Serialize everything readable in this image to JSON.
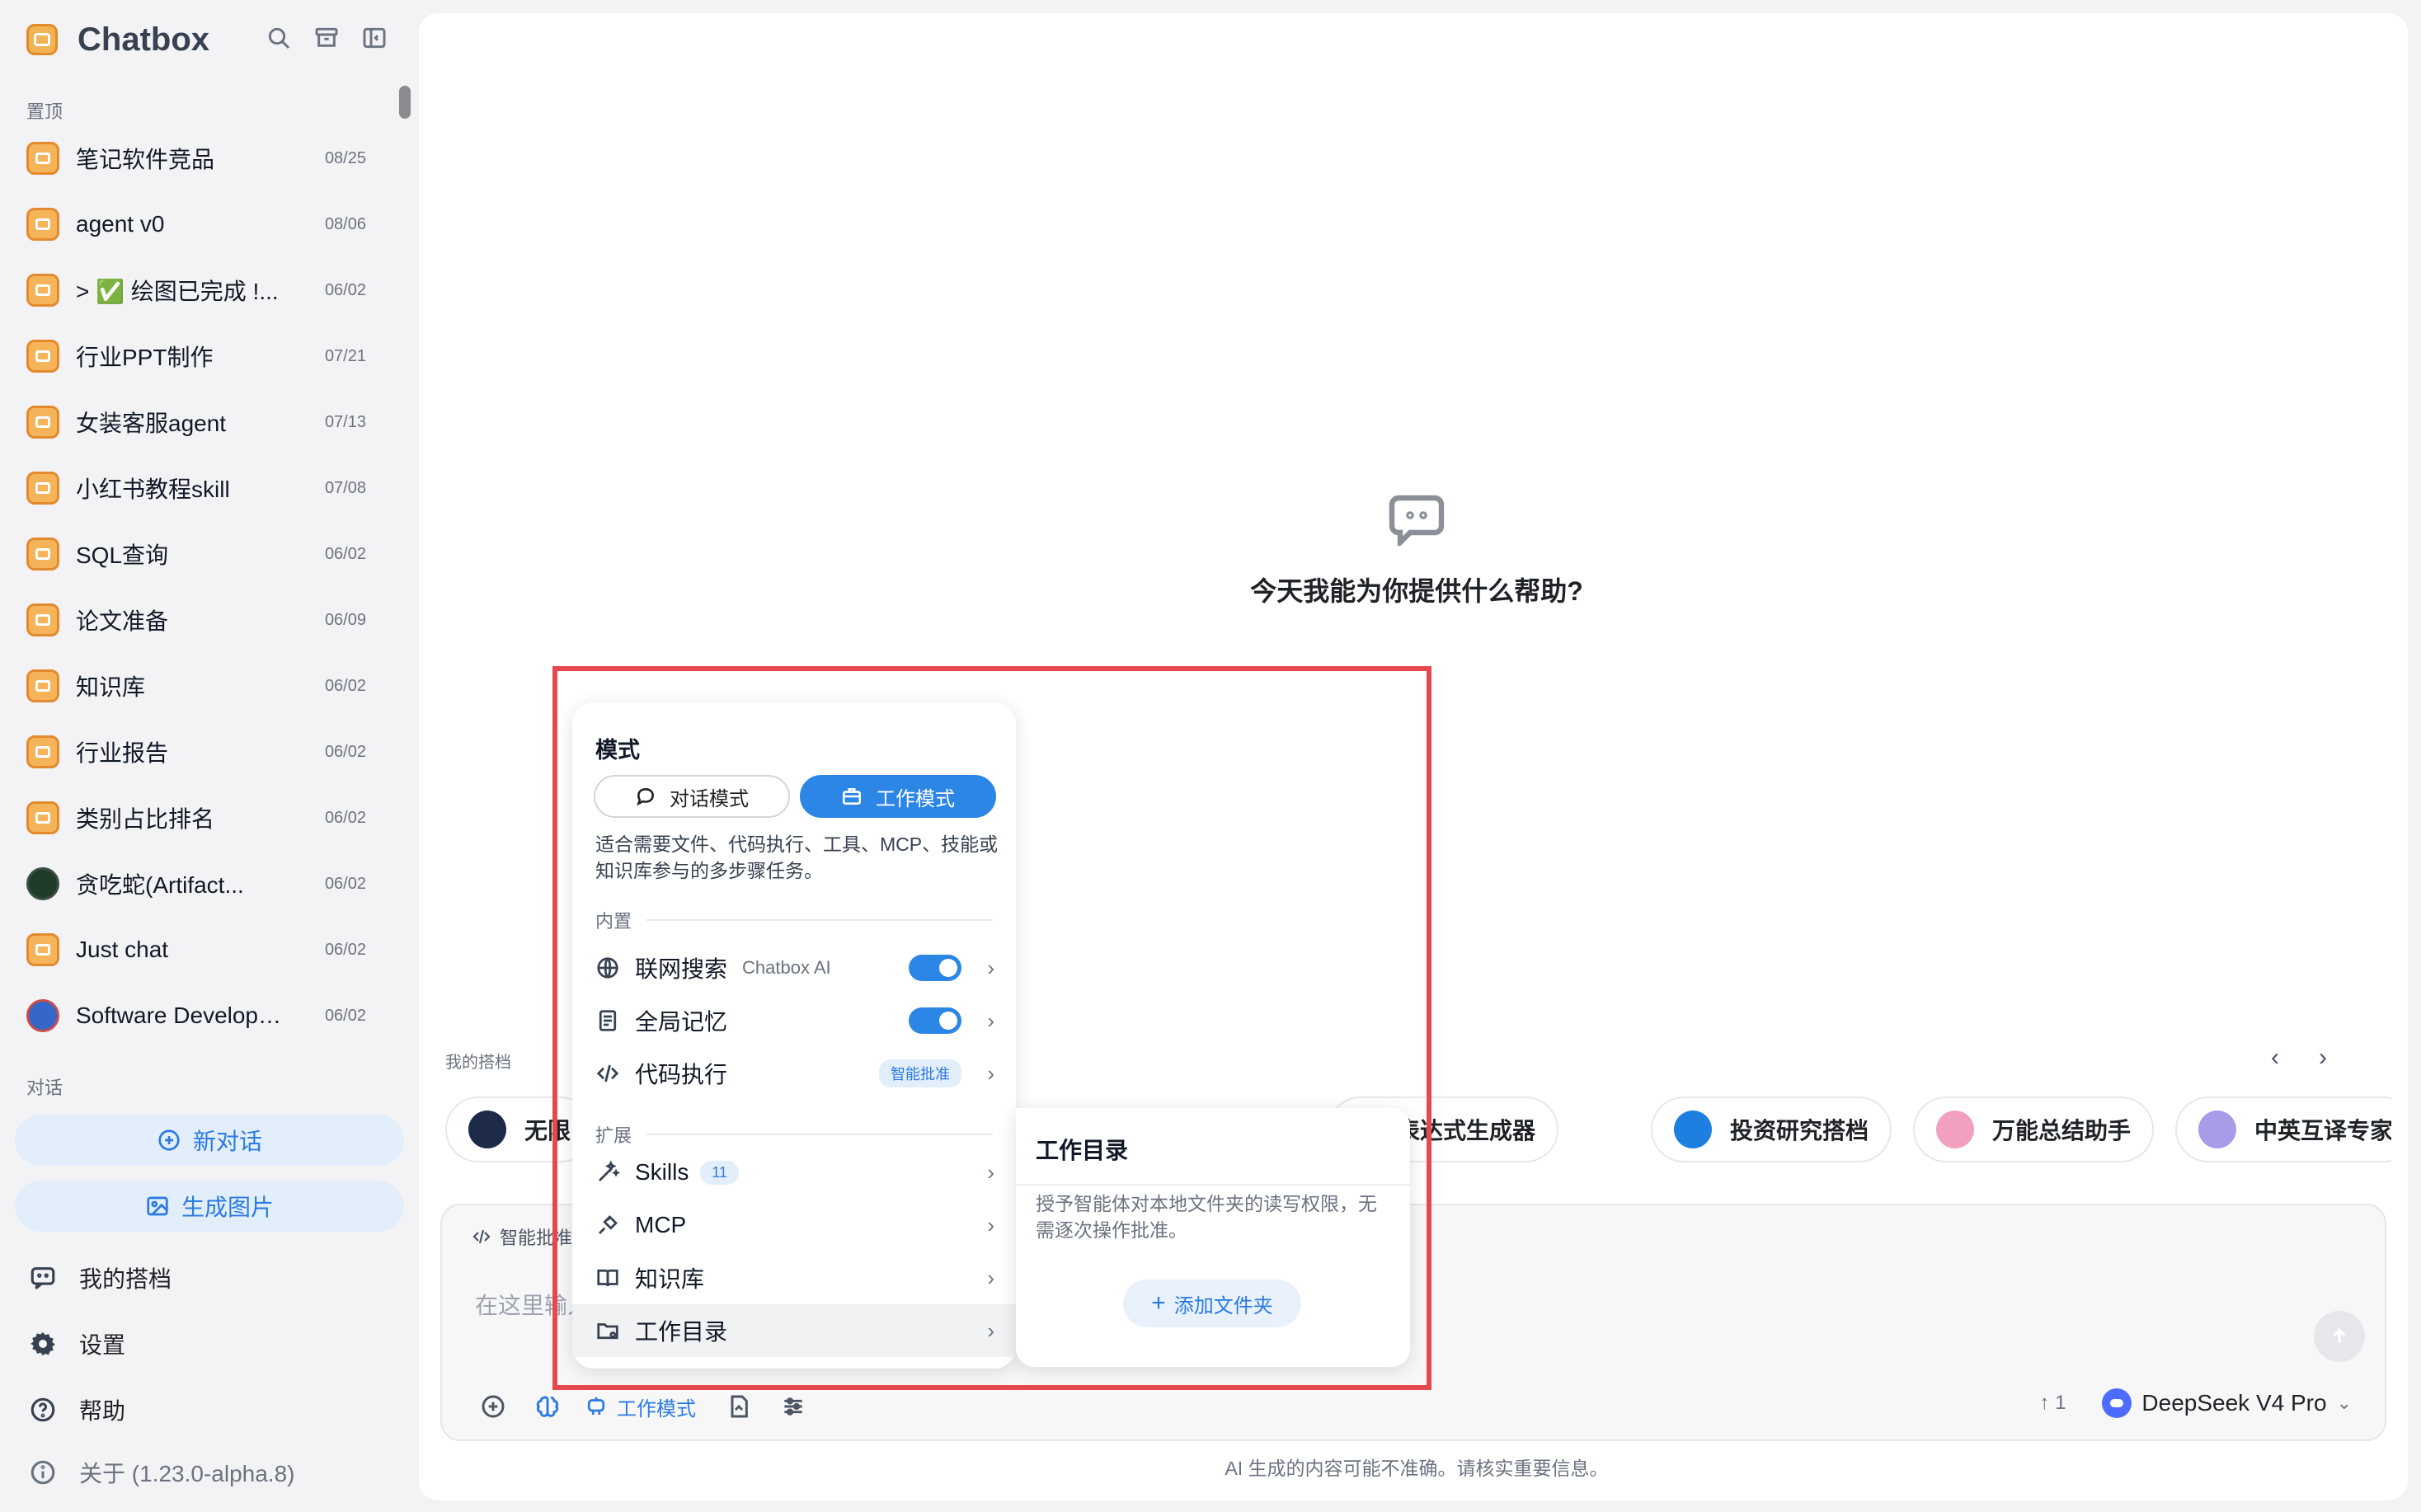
{
  "app": {
    "title": "Chatbox"
  },
  "sidebar": {
    "pinned_label": "置顶",
    "conversations_label": "对话",
    "items": [
      {
        "name": "笔记软件竞品",
        "date": "08/25",
        "avatar": "chatbox"
      },
      {
        "name": "agent v0",
        "date": "08/06",
        "avatar": "chatbox"
      },
      {
        "name": "> ✅ 绘图已完成 !...",
        "date": "06/02",
        "avatar": "chatbox"
      },
      {
        "name": "行业PPT制作",
        "date": "07/21",
        "avatar": "chatbox"
      },
      {
        "name": "女装客服agent",
        "date": "07/13",
        "avatar": "chatbox"
      },
      {
        "name": "小红书教程skill",
        "date": "07/08",
        "avatar": "chatbox"
      },
      {
        "name": "SQL查询",
        "date": "06/02",
        "avatar": "chatbox"
      },
      {
        "name": "论文准备",
        "date": "06/09",
        "avatar": "chatbox"
      },
      {
        "name": "知识库",
        "date": "06/02",
        "avatar": "chatbox"
      },
      {
        "name": "行业报告",
        "date": "06/02",
        "avatar": "chatbox"
      },
      {
        "name": "类别占比排名",
        "date": "06/02",
        "avatar": "chatbox"
      },
      {
        "name": "贪吃蛇(Artifact...",
        "date": "06/02",
        "avatar": "snake"
      },
      {
        "name": "Just chat",
        "date": "06/02",
        "avatar": "chatbox"
      },
      {
        "name": "Software Developer...",
        "date": "06/02",
        "avatar": "developer"
      }
    ],
    "new_chat_label": "新对话",
    "generate_image_label": "生成图片",
    "links": {
      "partners": "我的搭档",
      "settings": "设置",
      "help": "帮助",
      "about": "关于 (1.23.0-alpha.8)"
    }
  },
  "main": {
    "welcome_text": "今天我能为你提供什么帮助?",
    "partners_label": "我的搭档",
    "partners": [
      {
        "name": "无限",
        "color": "#1e2a4a"
      },
      {
        "name": "正则表达式生成器",
        "color": "#ffffff"
      },
      {
        "name": "投资研究搭档",
        "color": "#1d7fe0"
      },
      {
        "name": "万能总结助手",
        "color": "#f3a0c0"
      },
      {
        "name": "中英互译专家",
        "color": "#a99be8"
      }
    ],
    "composer": {
      "badge": "智能批准",
      "placeholder": "在这里输入你的问题...",
      "mode_label": "工作模式",
      "count": "↑ 1",
      "model": "DeepSeek V4 Pro"
    },
    "disclaimer": "AI 生成的内容可能不准确。请核实重要信息。"
  },
  "mode_menu": {
    "title": "模式",
    "chat_mode": "对话模式",
    "work_mode": "工作模式",
    "description": "适合需要文件、代码执行、工具、MCP、技能或知识库参与的多步骤任务。",
    "builtin_label": "内置",
    "web_search": "联网搜索",
    "web_search_provider": "Chatbox AI",
    "global_memory": "全局记忆",
    "code_exec": "代码执行",
    "code_exec_badge": "智能批准",
    "extensions_label": "扩展",
    "skills": "Skills",
    "skills_count": "11",
    "mcp": "MCP",
    "knowledge_base": "知识库",
    "work_dir": "工作目录"
  },
  "work_dir_submenu": {
    "title": "工作目录",
    "description": "授予智能体对本地文件夹的读写权限，无需逐次操作批准。",
    "add_folder": "添加文件夹"
  },
  "colors": {
    "accent": "#2b86e6",
    "highlight": "#e5484d",
    "brand": "#f1b455"
  }
}
